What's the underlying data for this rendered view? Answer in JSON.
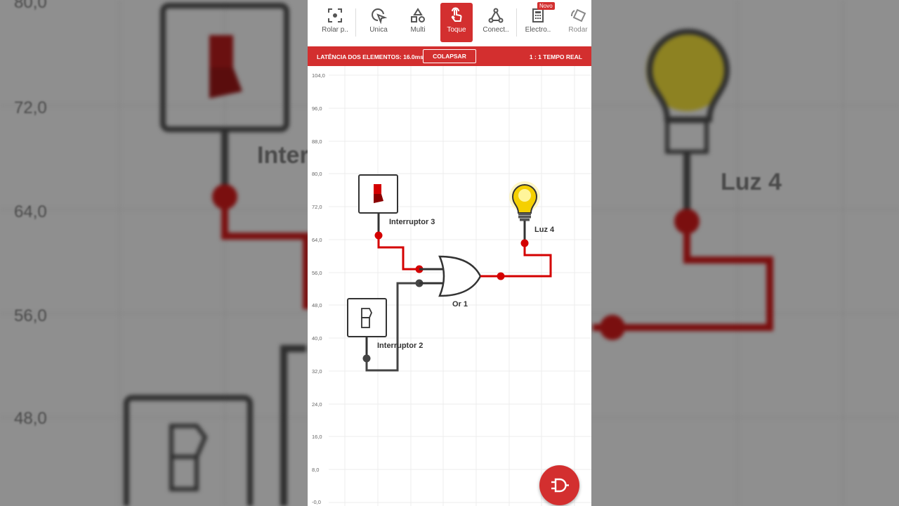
{
  "toolbar": {
    "items": [
      {
        "label": "Rolar p..",
        "icon": "scroll-focus-icon"
      },
      {
        "label": "Única",
        "icon": "single-select-icon"
      },
      {
        "label": "Multi",
        "icon": "multi-shapes-icon"
      },
      {
        "label": "Toque",
        "icon": "touch-hand-icon",
        "active": true
      },
      {
        "label": "Conect..",
        "icon": "connect-nodes-icon"
      },
      {
        "label": "Electro..",
        "icon": "calculator-icon",
        "badge": "Novo"
      },
      {
        "label": "Rodar",
        "icon": "rotate-icon"
      }
    ]
  },
  "status_bar": {
    "latency": "LATÊNCIA DOS ELEMENTOS: 16.0ms",
    "collapse_label": "COLAPSAR",
    "time_mode": "1 : 1 TEMPO REAL"
  },
  "axis": {
    "ticks": [
      "104,0",
      "96,0",
      "88,0",
      "80,0",
      "72,0",
      "64,0",
      "56,0",
      "48,0",
      "40,0",
      "32,0",
      "24,0",
      "16,0",
      "8,0",
      "-0,0"
    ]
  },
  "components": {
    "switch3": "Interruptor 3",
    "switch2": "Interruptor 2",
    "or_gate": "Or 1",
    "light": "Luz 4"
  },
  "background": {
    "ticks": [
      "80,0",
      "72,0",
      "64,0",
      "56,0",
      "48,0"
    ],
    "label_left": "Inter",
    "label_right": "Luz 4"
  },
  "colors": {
    "accent": "#d32f2f",
    "wire_on": "#d40000",
    "wire_off": "#444444"
  }
}
